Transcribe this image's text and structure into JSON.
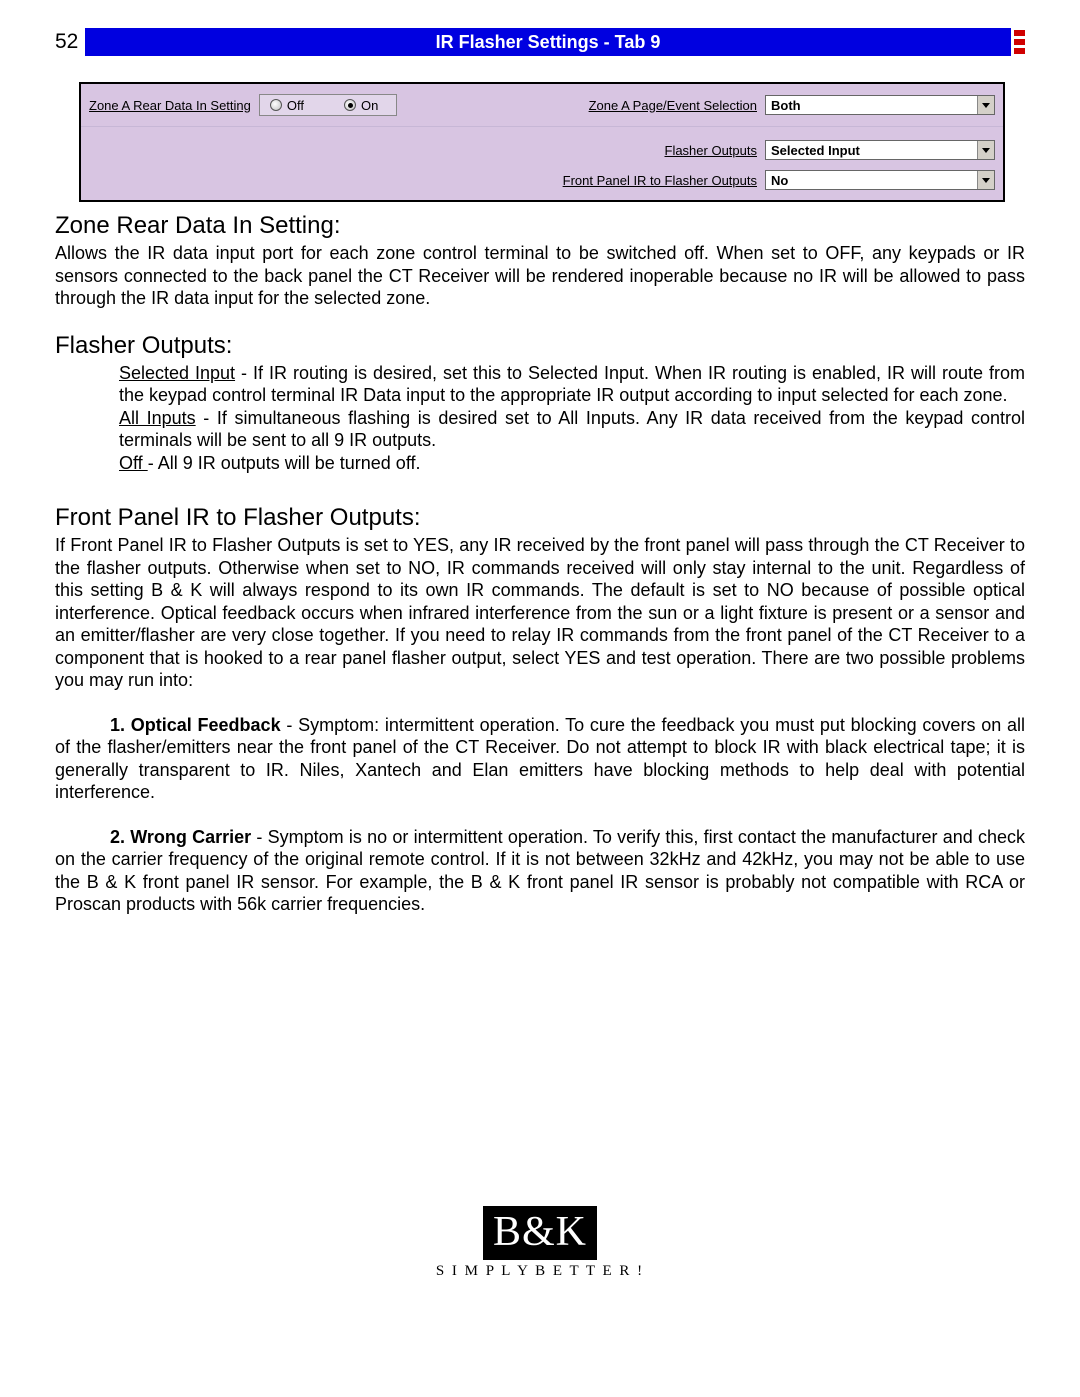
{
  "page_number": "52",
  "header_title": "IR Flasher Settings - Tab 9",
  "settings": {
    "zone_rear_label": "Zone A Rear Data In Setting",
    "radio_off_label": "Off",
    "radio_on_label": "On",
    "radio_selected": "On",
    "page_event_label": "Zone A Page/Event Selection",
    "page_event_value": "Both",
    "flasher_outputs_label": "Flasher Outputs",
    "flasher_outputs_value": "Selected Input",
    "front_ir_label": "Front Panel IR to Flasher Outputs",
    "front_ir_value": "No"
  },
  "sections": {
    "s1_heading": "Zone Rear Data In Setting:",
    "s1_body": "Allows the IR data input port for each zone control terminal to be switched off.  When set to OFF, any keypads or IR sensors connected to the back panel the CT Receiver will be rendered inoperable because no IR will be allowed to pass through the IR data input for the selected zone.",
    "s2_heading": "Flasher Outputs:",
    "s2_sel_label": "Selected Input",
    "s2_sel_body": " - If IR routing is desired, set this to Selected Input.  When IR routing is enabled, IR will route from the keypad control terminal IR Data input to the appropriate IR output according to input selected for each zone.",
    "s2_all_label": "All Inputs",
    "s2_all_body": " - If simultaneous flashing is desired set to All Inputs.  Any IR data received from the keypad control terminals will be sent to all 9 IR outputs.",
    "s2_off_label": "Off ",
    "s2_off_body": "- All 9 IR outputs will be turned off.",
    "s3_heading": "Front Panel IR to Flasher Outputs:",
    "s3_body": "If Front Panel IR to Flasher Outputs is set to YES, any IR received by the front panel will pass through the CT Receiver to the flasher outputs.  Otherwise when set to NO, IR commands received will only stay internal to the unit.  Regardless of this setting B & K  will always respond to its own IR commands. The default is set to NO because of possible optical interference.  Optical feedback occurs when infrared interference from the sun or a light fixture is present or a sensor and an emitter/flasher are very close together. If you need to relay IR commands from the front panel of the CT Receiver to a component that is hooked to a rear panel flasher output, select YES and test operation. There are two possible problems you may run into:",
    "p1_lead": "1. Optical Feedback",
    "p1_body": " - Symptom: intermittent operation. To cure the feedback you must put blocking covers on all of the flasher/emitters near the front panel of the CT Receiver. Do not attempt to block IR with black electrical tape; it is generally transparent to IR. Niles, Xantech and Elan emitters have blocking methods to help deal with potential interference.",
    "p2_lead": "2. Wrong Carrier",
    "p2_body": " - Symptom is no or intermittent operation. To verify this, first contact the manufacturer and check on the carrier frequency of the original remote control. If it is not between 32kHz and 42kHz, you may not be able to use the B & K  front panel IR sensor. For example, the B &  K  front panel IR sensor is probably not compatible with RCA or Proscan products with 56k carrier frequencies."
  },
  "footer": {
    "logo_text": "B&K",
    "tagline": "S I M P L Y  B E T T E R !"
  }
}
